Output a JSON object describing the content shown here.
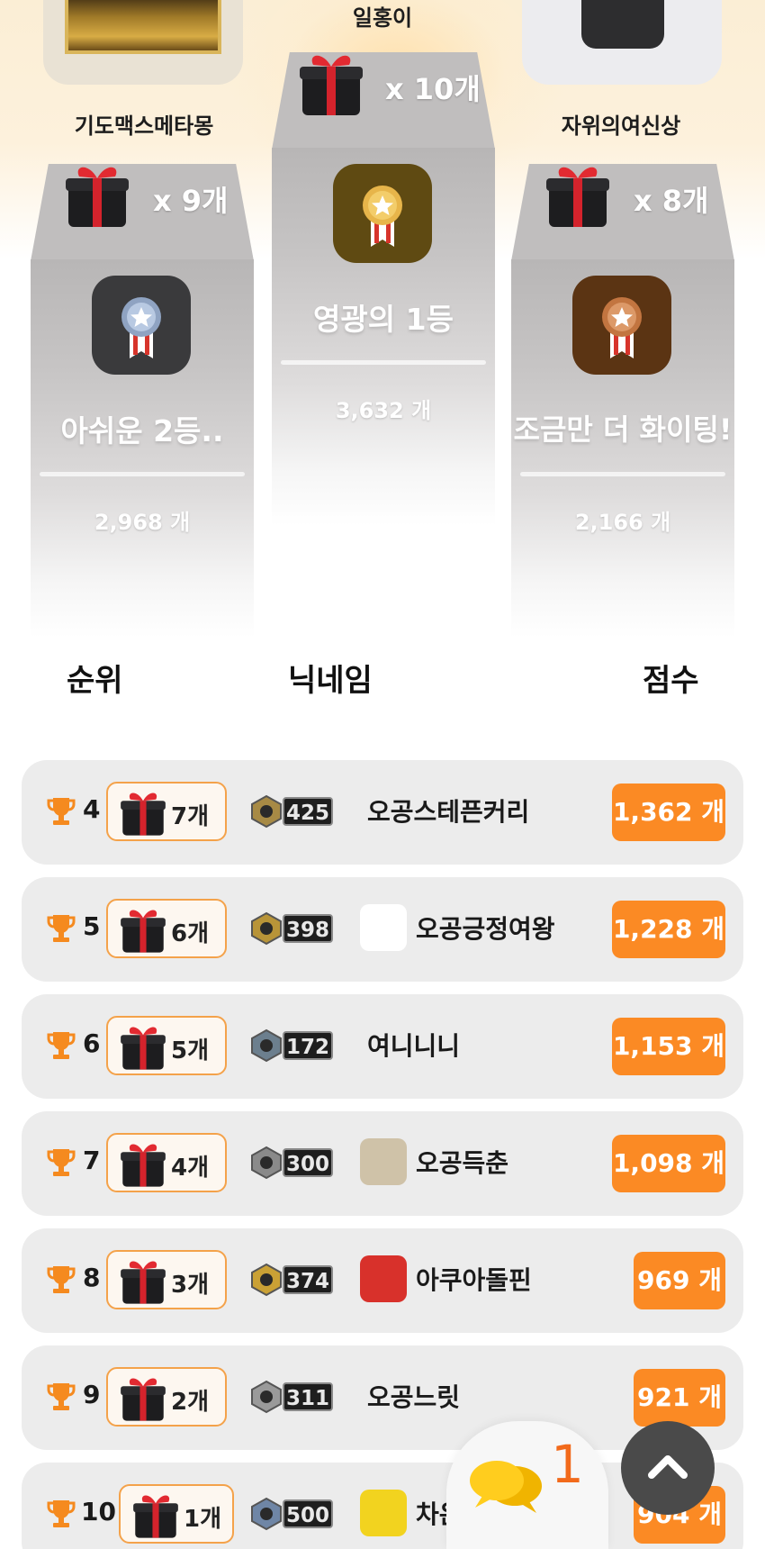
{
  "podium": {
    "first": {
      "nickname": "일홍이",
      "gift_count": "x 10개",
      "title": "영광의 1등",
      "score": "3,632 개",
      "medal_color": "#d9a53a"
    },
    "second": {
      "nickname": "기도맥스메타몽",
      "gift_count": "x 9개",
      "title": "아쉬운 2등..",
      "score": "2,968 개",
      "medal_color": "#9fb3cf"
    },
    "third": {
      "nickname": "자위의여신상",
      "gift_count": "x 8개",
      "title": "조금만 더 화이팅!",
      "score": "2,166 개",
      "medal_color": "#c98247"
    }
  },
  "headers": {
    "rank": "순위",
    "nickname": "닉네임",
    "score": "점수"
  },
  "ranking": [
    {
      "rank": "4",
      "gifts": "7개",
      "level": "425",
      "nickname": "오공스테픈커리",
      "score": "1,362 개"
    },
    {
      "rank": "5",
      "gifts": "6개",
      "level": "398",
      "nickname": "오공긍정여왕",
      "score": "1,228 개"
    },
    {
      "rank": "6",
      "gifts": "5개",
      "level": "172",
      "nickname": "여니니니",
      "score": "1,153 개"
    },
    {
      "rank": "7",
      "gifts": "4개",
      "level": "300",
      "nickname": "오공득춘",
      "score": "1,098 개"
    },
    {
      "rank": "8",
      "gifts": "3개",
      "level": "374",
      "nickname": "아쿠아돌핀",
      "score": "969 개"
    },
    {
      "rank": "9",
      "gifts": "2개",
      "level": "311",
      "nickname": "오공느릿",
      "score": "921 개"
    },
    {
      "rank": "10",
      "gifts": "1개",
      "level": "500",
      "nickname": "차은우",
      "score": "904 개"
    }
  ],
  "chat": {
    "unread": "1",
    "icon": "chat-bubbles-icon"
  },
  "scroll_top": {
    "icon": "chevron-up-icon"
  },
  "colors": {
    "accent": "#fb8a24",
    "gift_border": "#f4a24a",
    "row_bg": "#ececec"
  }
}
